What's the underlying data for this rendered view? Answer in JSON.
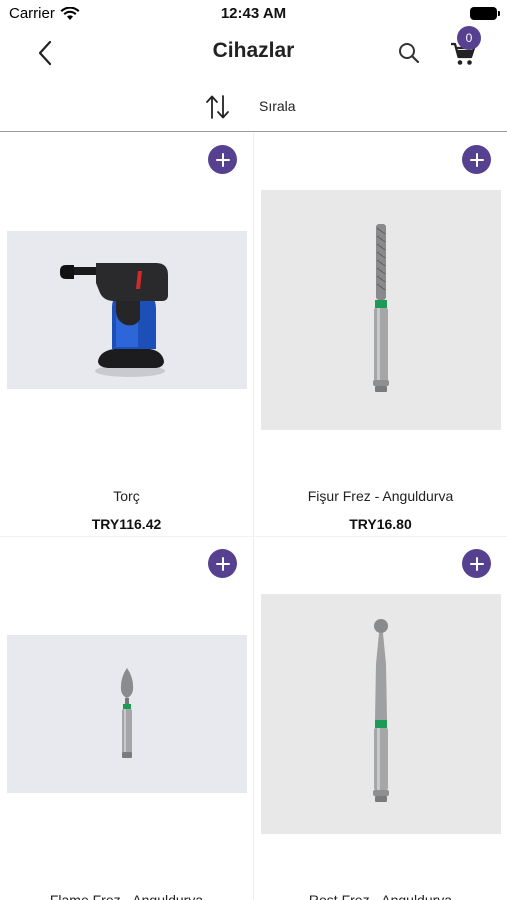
{
  "status_bar": {
    "carrier": "Carrier",
    "time": "12:43 AM"
  },
  "nav": {
    "title": "Cihazlar",
    "cart_count": "0"
  },
  "sort": {
    "label": "Sırala"
  },
  "colors": {
    "accent": "#55418f"
  },
  "products": [
    {
      "name": "Torç",
      "price": "TRY116.42",
      "image": "torch-image"
    },
    {
      "name": "Fişur Frez - Anguldurva",
      "price": "TRY16.80",
      "image": "fissure-bur-image"
    },
    {
      "name": "Flame Frez - Anguldurva",
      "price": "",
      "image": "flame-bur-image"
    },
    {
      "name": "Rost Frez - Anguldurva",
      "price": "",
      "image": "round-bur-image"
    }
  ]
}
